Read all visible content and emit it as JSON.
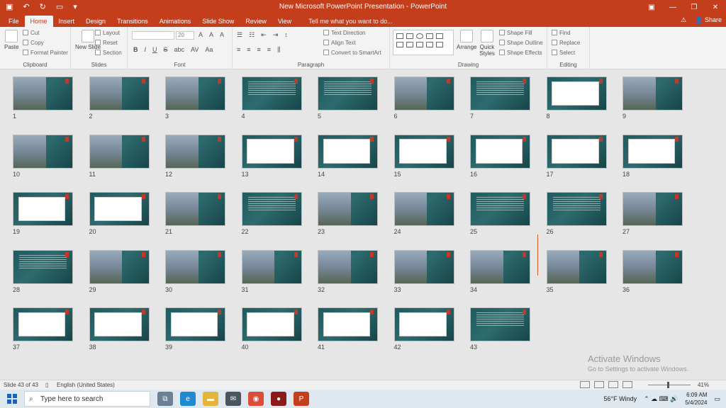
{
  "title_bar": {
    "title": "New Microsoft PowerPoint Presentation - PowerPoint",
    "qat": [
      "save-icon",
      "undo-icon",
      "redo-icon",
      "present-icon",
      "customize-icon"
    ]
  },
  "tabs": [
    "File",
    "Home",
    "Insert",
    "Design",
    "Transitions",
    "Animations",
    "Slide Show",
    "Review",
    "View"
  ],
  "tell_me": "Tell me what you want to do...",
  "share": "Share",
  "ribbon": {
    "clipboard": {
      "label": "Clipboard",
      "paste": "Paste",
      "cut": "Cut",
      "copy": "Copy",
      "format_painter": "Format Painter"
    },
    "slides": {
      "label": "Slides",
      "new_slide": "New Slide",
      "layout": "Layout",
      "reset": "Reset",
      "section": "Section"
    },
    "font": {
      "label": "Font",
      "size": "20",
      "bold": "B",
      "italic": "I",
      "underline": "U",
      "strike": "S",
      "shadow": "abc",
      "spacing": "AV",
      "case": "Aa",
      "grow": "A",
      "shrink": "A",
      "clear": "A"
    },
    "paragraph": {
      "label": "Paragraph",
      "text_direction": "Text Direction",
      "align_text": "Align Text",
      "convert": "Convert to SmartArt"
    },
    "drawing": {
      "label": "Drawing",
      "arrange": "Arrange",
      "quick_styles": "Quick Styles",
      "shape_fill": "Shape Fill",
      "shape_outline": "Shape Outline",
      "shape_effects": "Shape Effects"
    },
    "editing": {
      "label": "Editing",
      "find": "Find",
      "replace": "Replace",
      "select": "Select"
    }
  },
  "slides": [
    {
      "n": "1",
      "k": "pic"
    },
    {
      "n": "2",
      "k": "pic"
    },
    {
      "n": "3",
      "k": "pic"
    },
    {
      "n": "4",
      "k": "txt"
    },
    {
      "n": "5",
      "k": "txt"
    },
    {
      "n": "6",
      "k": "pic"
    },
    {
      "n": "7",
      "k": "txt"
    },
    {
      "n": "8",
      "k": "white"
    },
    {
      "n": "9",
      "k": "pic"
    },
    {
      "n": "10",
      "k": "pic"
    },
    {
      "n": "11",
      "k": "pic"
    },
    {
      "n": "12",
      "k": "pic"
    },
    {
      "n": "13",
      "k": "white"
    },
    {
      "n": "14",
      "k": "white"
    },
    {
      "n": "15",
      "k": "white"
    },
    {
      "n": "16",
      "k": "white"
    },
    {
      "n": "17",
      "k": "white"
    },
    {
      "n": "18",
      "k": "white"
    },
    {
      "n": "19",
      "k": "white"
    },
    {
      "n": "20",
      "k": "white"
    },
    {
      "n": "21",
      "k": "pic"
    },
    {
      "n": "22",
      "k": "txt"
    },
    {
      "n": "23",
      "k": "pic"
    },
    {
      "n": "24",
      "k": "pic"
    },
    {
      "n": "25",
      "k": "txt"
    },
    {
      "n": "26",
      "k": "txt"
    },
    {
      "n": "27",
      "k": "pic"
    },
    {
      "n": "28",
      "k": "txt"
    },
    {
      "n": "29",
      "k": "pic"
    },
    {
      "n": "30",
      "k": "pic"
    },
    {
      "n": "31",
      "k": "pic"
    },
    {
      "n": "32",
      "k": "pic"
    },
    {
      "n": "33",
      "k": "pic"
    },
    {
      "n": "34",
      "k": "pic"
    },
    {
      "n": "35",
      "k": "pic"
    },
    {
      "n": "36",
      "k": "pic"
    },
    {
      "n": "37",
      "k": "white"
    },
    {
      "n": "38",
      "k": "white"
    },
    {
      "n": "39",
      "k": "white"
    },
    {
      "n": "40",
      "k": "white"
    },
    {
      "n": "41",
      "k": "white"
    },
    {
      "n": "42",
      "k": "white"
    },
    {
      "n": "43",
      "k": "txt"
    }
  ],
  "watermark": {
    "line1": "Activate Windows",
    "line2": "Go to Settings to activate Windows."
  },
  "status": {
    "slide": "Slide 43 of 43",
    "language": "English (United States)",
    "zoom": "41%",
    "zoom_fraction": 0.41
  },
  "taskbar": {
    "search": "Type here to search",
    "weather": "56°F  Windy",
    "time": "6:09 AM",
    "date": "5/4/2024"
  },
  "colors": {
    "accent": "#c43e1c",
    "slide_bg": "#1f5a5e"
  }
}
